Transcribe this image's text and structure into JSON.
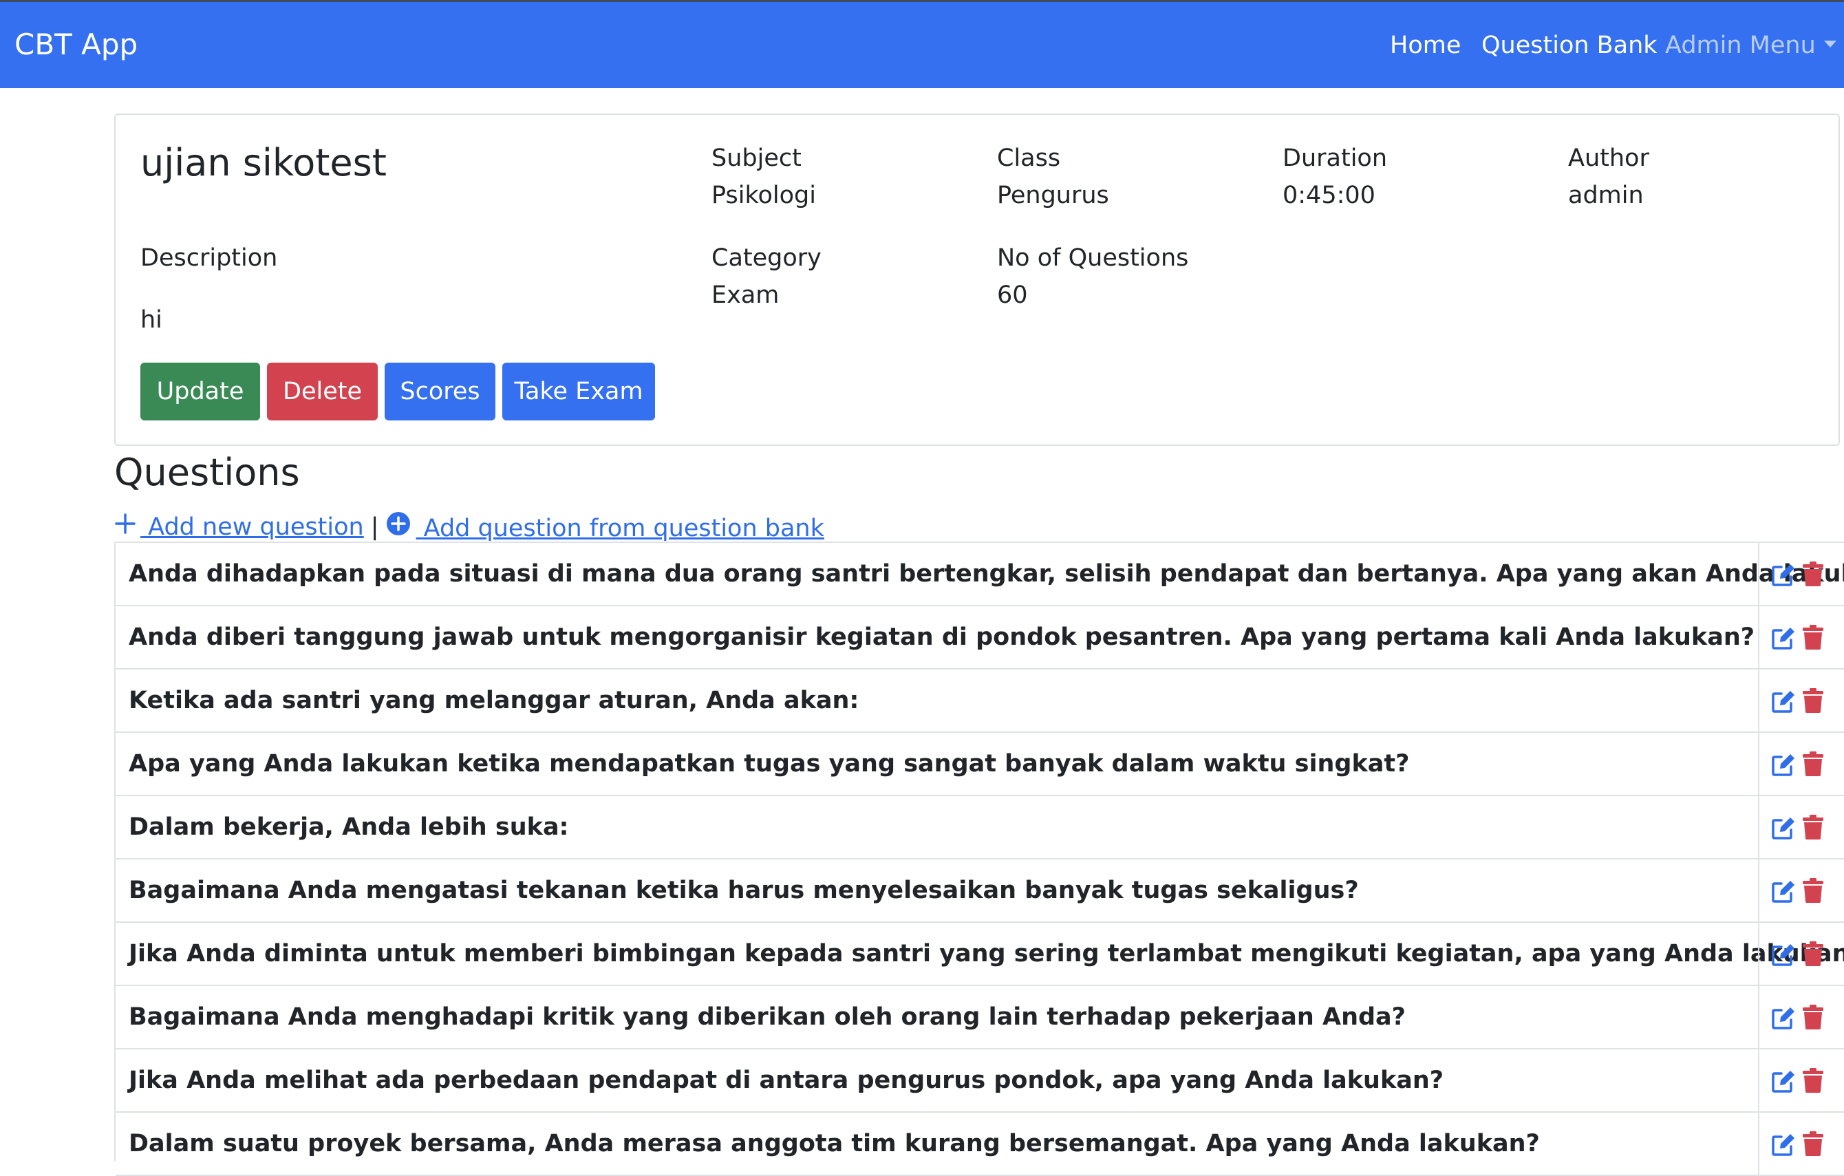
{
  "navbar": {
    "brand": "CBT App",
    "home": "Home",
    "question_bank": "Question Bank",
    "admin_menu": "Admin Menu"
  },
  "exam": {
    "title": "ujian sikotest",
    "subject_label": "Subject",
    "subject": "Psikologi",
    "class_label": "Class",
    "class": "Pengurus",
    "duration_label": "Duration",
    "duration": "0:45:00",
    "author_label": "Author",
    "author": "admin",
    "description_label": "Description",
    "description": "hi",
    "category_label": "Category",
    "category": "Exam",
    "num_questions_label": "No of Questions",
    "num_questions": "60"
  },
  "actions": {
    "update": "Update",
    "delete": "Delete",
    "scores": "Scores",
    "take_exam": "Take Exam"
  },
  "questions_section": {
    "title": "Questions",
    "add_new": " Add new question",
    "separator": "|",
    "add_from_bank": " Add question from question bank"
  },
  "questions": [
    "Anda dihadapkan pada situasi di mana dua orang santri bertengkar, selisih pendapat dan bertanya. Apa yang akan Anda lakukan?",
    "Anda diberi tanggung jawab untuk mengorganisir kegiatan di pondok pesantren. Apa yang pertama kali Anda lakukan?",
    "Ketika ada santri yang melanggar aturan, Anda akan:",
    "Apa yang Anda lakukan ketika mendapatkan tugas yang sangat banyak dalam waktu singkat?",
    "Dalam bekerja, Anda lebih suka:",
    "Bagaimana Anda mengatasi tekanan ketika harus menyelesaikan banyak tugas sekaligus?",
    "Jika Anda diminta untuk memberi bimbingan kepada santri yang sering terlambat mengikuti kegiatan, apa yang Anda lakukan?",
    "Bagaimana Anda menghadapi kritik yang diberikan oleh orang lain terhadap pekerjaan Anda?",
    "Jika Anda melihat ada perbedaan pendapat di antara pengurus pondok, apa yang Anda lakukan?",
    "Dalam suatu proyek bersama, Anda merasa anggota tim kurang bersemangat. Apa yang Anda lakukan?"
  ],
  "colors": {
    "navbar": "#3470f0",
    "update": "#3a8a55",
    "delete": "#d2434f",
    "primary": "#3470f0",
    "link": "#2f6ee8",
    "trash": "#d2434f"
  },
  "icons": {
    "edit": "edit-icon",
    "delete": "trash-icon",
    "add": "plus-icon",
    "add_from_bank": "circle-plus-icon"
  }
}
